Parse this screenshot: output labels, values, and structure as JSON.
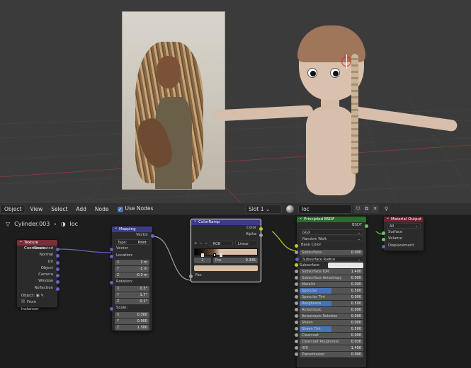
{
  "viewport": {
    "scene": "3D viewport with reference photo plane and stylized character"
  },
  "header": {
    "mode": "Object",
    "menus": [
      "View",
      "Select",
      "Add",
      "Node"
    ],
    "use_nodes_label": "Use Nodes",
    "slot": "Slot 1",
    "material_name": "loc"
  },
  "breadcrumb": {
    "object": "Cylinder.003",
    "material": "loc"
  },
  "nodes": {
    "texcoord": {
      "title": "Texture Coordinate",
      "outputs": [
        "Generated",
        "Normal",
        "UV",
        "Object",
        "Camera",
        "Window",
        "Reflection"
      ],
      "object_label": "Object:",
      "from_instancer": "From Instancer"
    },
    "mapping": {
      "title": "Mapping",
      "out": "Vector",
      "type_label": "Type:",
      "type_value": "Point",
      "vector": "Vector",
      "location": "Location:",
      "loc": [
        [
          "X",
          "1 m"
        ],
        [
          "Y",
          "-1 m"
        ],
        [
          "Z",
          "-0.3 m"
        ]
      ],
      "rotation": "Rotation:",
      "rot": [
        [
          "X",
          "0.3°"
        ],
        [
          "Y",
          "1.7°"
        ],
        [
          "Z",
          "0.1°"
        ]
      ],
      "scale": "Scale:",
      "scl": [
        [
          "X",
          "0.300"
        ],
        [
          "Y",
          "0.900"
        ],
        [
          "Z",
          "1.300"
        ]
      ]
    },
    "colorramp": {
      "title": "ColorRamp",
      "out_color": "Color",
      "out_alpha": "Alpha",
      "plus": "+",
      "minus": "−",
      "mode": "RGB",
      "interp": "Linear",
      "index": "2",
      "pos_label": "Pos",
      "pos_value": "0.336",
      "fac": "Fac"
    },
    "bsdf": {
      "title": "Principled BSDF",
      "out": "BSDF",
      "dist": "GGX",
      "sss_method": "Random Walk",
      "base_color": "Base Color",
      "props": [
        [
          "Subsurface",
          "0.000"
        ],
        [
          "Subsurface Radius",
          ""
        ],
        [
          "Subsurface Co...",
          ""
        ],
        [
          "Subsurface IOR",
          "1.400"
        ],
        [
          "Subsurface Anisotropy",
          "0.000"
        ],
        [
          "Metallic",
          "0.000"
        ],
        [
          "Specular",
          "0.500"
        ],
        [
          "Specular Tint",
          "0.000"
        ],
        [
          "Roughness",
          "0.500"
        ],
        [
          "Anisotropic",
          "0.000"
        ],
        [
          "Anisotropic Rotation",
          "0.000"
        ],
        [
          "Sheen",
          "0.000"
        ],
        [
          "Sheen Tint",
          "0.500"
        ],
        [
          "Clearcoat",
          "0.000"
        ],
        [
          "Clearcoat Roughness",
          "0.030"
        ],
        [
          "IOR",
          "1.450"
        ],
        [
          "Transmission",
          "0.000"
        ]
      ]
    },
    "output": {
      "title": "Material Output",
      "target": "All",
      "inputs": [
        "Surface",
        "Volume",
        "Displacement"
      ]
    }
  },
  "colors": {
    "header_red": "#7b2d38",
    "header_blue": "#3b3b8a",
    "header_green": "#2d6a2d",
    "header_dark_red": "#6e2030",
    "socket_yellow": "#c7c729",
    "socket_purple": "#6363c7",
    "socket_gray": "#a1a1a1",
    "socket_green": "#63c763",
    "accent_blue": "#4772b3"
  }
}
